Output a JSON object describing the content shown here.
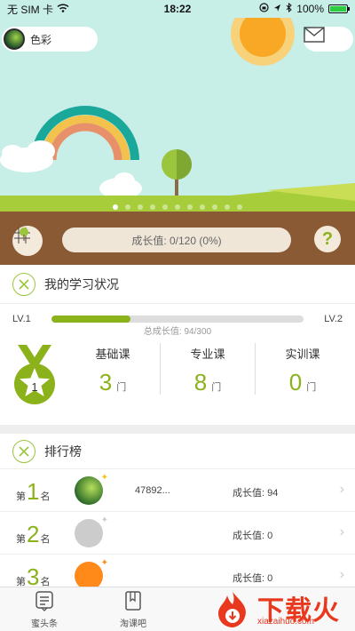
{
  "status_bar": {
    "carrier": "无 SIM 卡",
    "time": "18:22",
    "battery": "100%",
    "battery_level": 1.0
  },
  "header": {
    "user_name": "色彩"
  },
  "hero": {
    "page_count": 11,
    "active_page": 0,
    "growth_label": "成长值: 0/120 (0%)"
  },
  "study": {
    "title": "我的学习状况",
    "level_left": "LV.1",
    "level_right": "LV.2",
    "progress": 0.3133,
    "total_growth": "总成长值: 94/300",
    "medal_rank": "1",
    "courses": [
      {
        "name": "基础课",
        "count": "3",
        "unit": "门"
      },
      {
        "name": "专业课",
        "count": "8",
        "unit": "门"
      },
      {
        "name": "实训课",
        "count": "0",
        "unit": "门"
      }
    ]
  },
  "ranking": {
    "title": "排行榜",
    "rows": [
      {
        "prefix": "第",
        "rank": "1",
        "suffix": "名",
        "user": "47892...",
        "growth": "成长值: 94",
        "avatar_color": "#2e6b2a"
      },
      {
        "prefix": "第",
        "rank": "2",
        "suffix": "名",
        "user": "",
        "growth": "成长值: 0",
        "avatar_color": "#cccccc"
      },
      {
        "prefix": "第",
        "rank": "3",
        "suffix": "名",
        "user": "",
        "growth": "成长值: 0",
        "avatar_color": "#ff8a1a"
      }
    ]
  },
  "tabs": [
    {
      "label": "蜜头条",
      "icon": "news-icon"
    },
    {
      "label": "淘课吧",
      "icon": "book-icon"
    }
  ],
  "watermark": {
    "brand": "下载火",
    "domain": "xiazaihuo.com"
  }
}
